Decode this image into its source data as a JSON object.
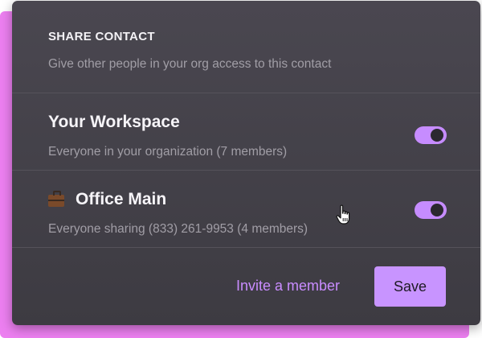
{
  "dialog": {
    "title": "SHARE CONTACT",
    "subtitle": "Give other people in your org access to this contact"
  },
  "rows": [
    {
      "title": "Your Workspace",
      "description": "Everyone in your organization (7 members)",
      "enabled": true,
      "icon": ""
    },
    {
      "title": "Office Main",
      "description": "Everyone sharing (833) 261-9953 (4 members)",
      "enabled": true,
      "icon": "briefcase-icon"
    }
  ],
  "footer": {
    "invite_label": "Invite a member",
    "save_label": "Save"
  },
  "colors": {
    "accent": "#c894ff",
    "backdrop": "#ec7ff0",
    "card": "#45434a"
  }
}
